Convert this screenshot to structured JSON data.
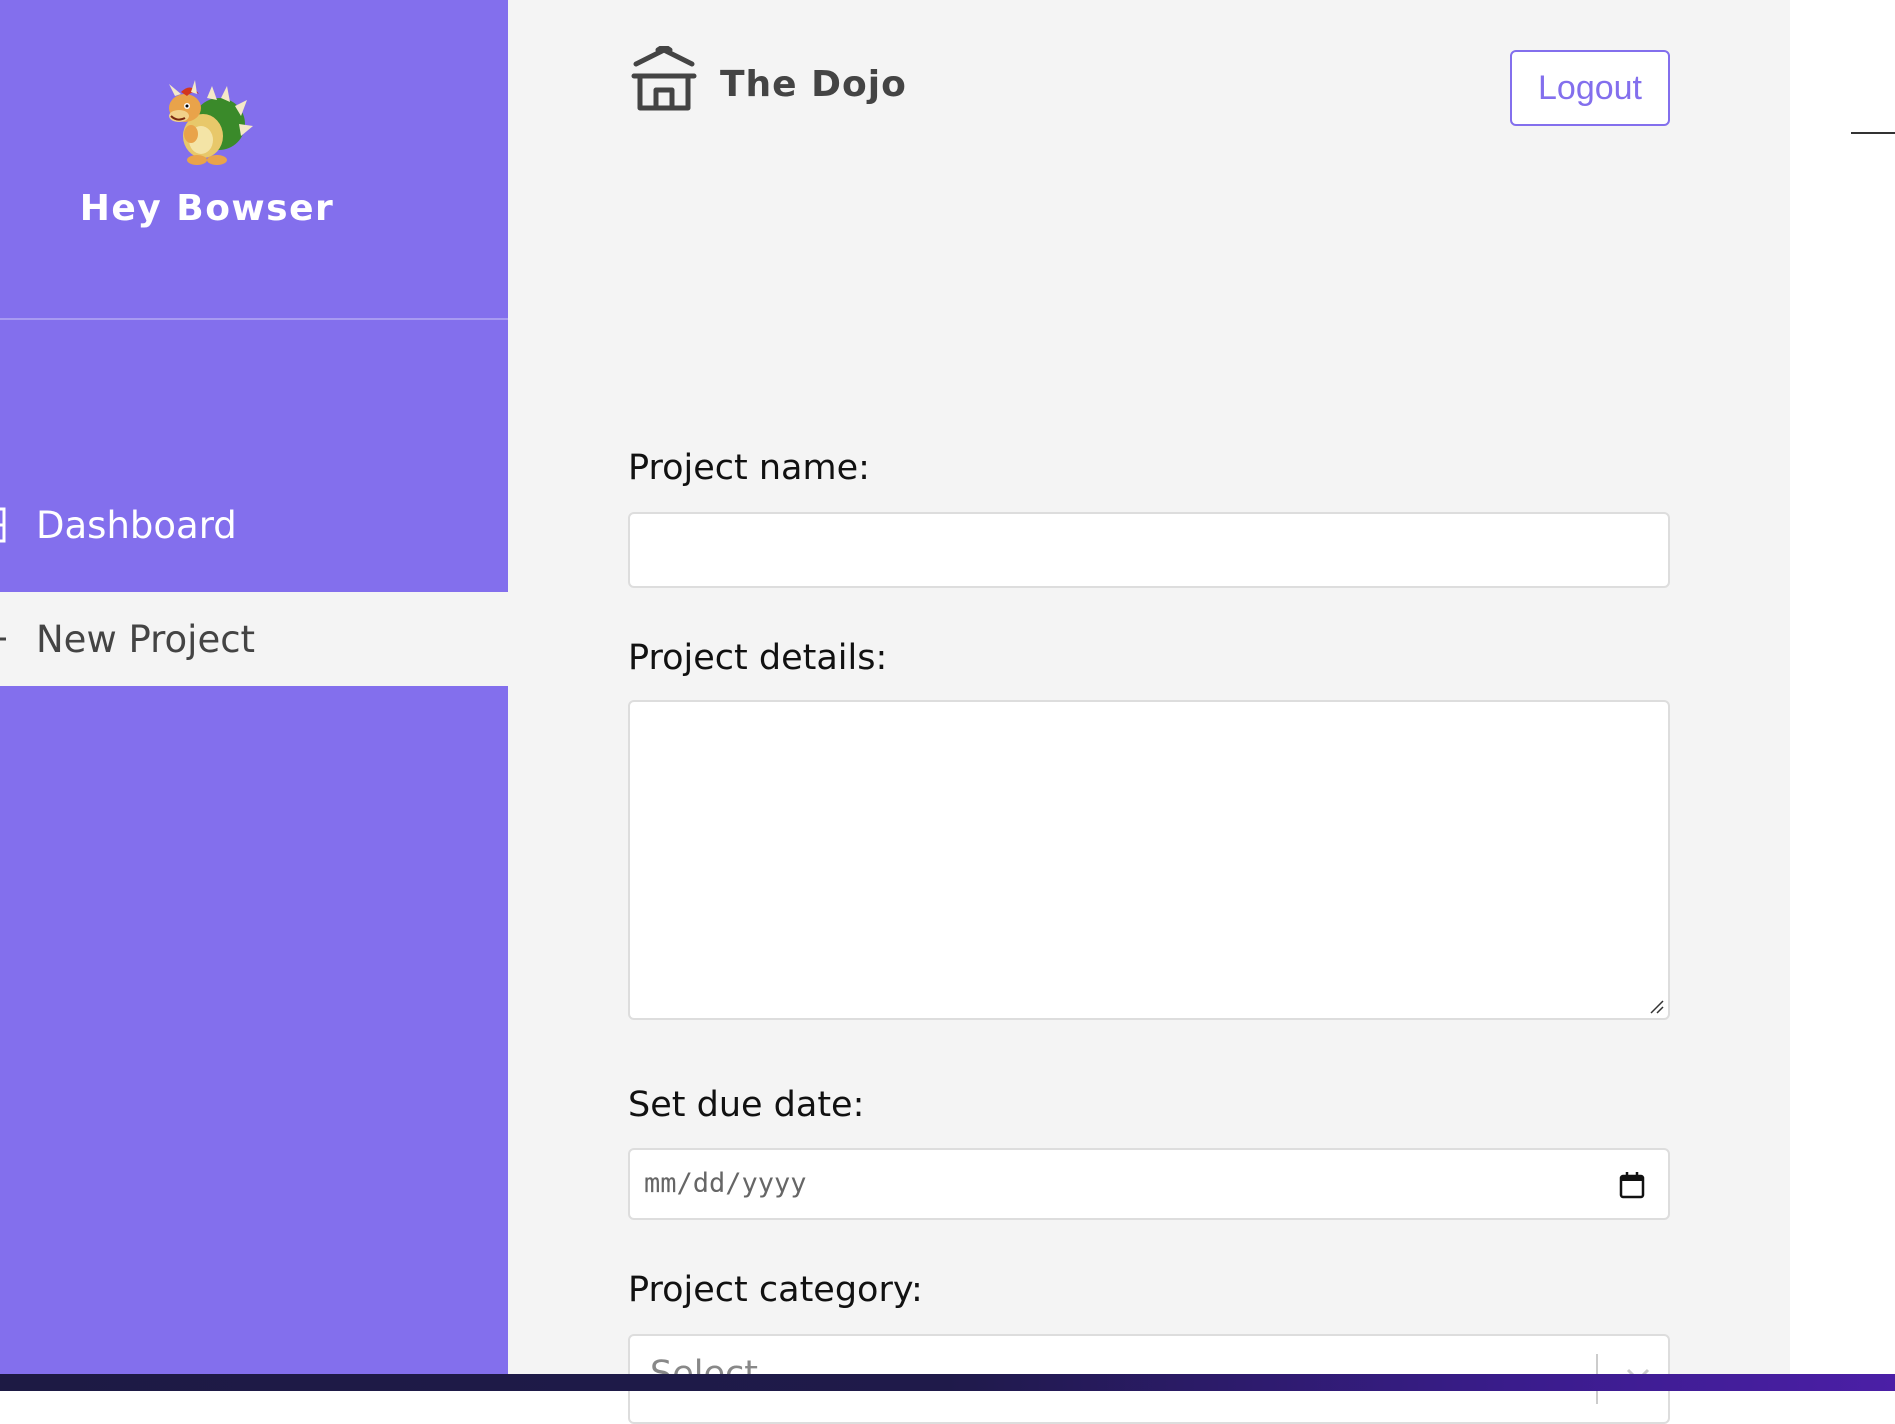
{
  "sidebar": {
    "user_greeting": "Hey Bowser",
    "nav": [
      {
        "label": "Dashboard",
        "icon": "dashboard-icon",
        "active": false
      },
      {
        "label": "New Project",
        "icon": "plus-icon",
        "active": true
      }
    ]
  },
  "header": {
    "brand_title": "The Dojo",
    "brand_icon": "temple-icon",
    "logout_label": "Logout"
  },
  "form": {
    "name_label": "Project name:",
    "name_value": "",
    "details_label": "Project details:",
    "details_value": "",
    "due_label": "Set due date:",
    "due_placeholder": "mm/dd/yyyy",
    "category_label": "Project category:",
    "category_placeholder": "Select..."
  },
  "colors": {
    "accent": "#836FED",
    "background": "#F4F4F4",
    "input_border": "#DDDDDD"
  }
}
